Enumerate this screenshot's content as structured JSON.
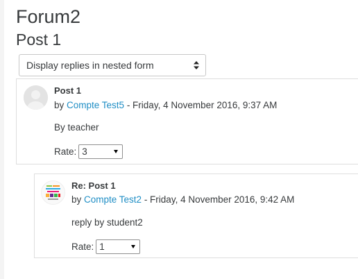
{
  "forum": {
    "title": "Forum2"
  },
  "discussion": {
    "title": "Post 1"
  },
  "display_mode": {
    "selected": "Display replies in nested form"
  },
  "posts": [
    {
      "subject": "Post 1",
      "by_prefix": "by",
      "author": "Compte Test5",
      "date_suffix": " - Friday, 4 November 2016, 9:37 AM",
      "content": "By teacher",
      "rate_label": "Rate:",
      "rate_value": "3",
      "avatar": "default-user-avatar-icon"
    },
    {
      "subject": "Re: Post 1",
      "by_prefix": "by",
      "author": "Compte Test2",
      "date_suffix": " - Friday, 4 November 2016, 9:42 AM",
      "content": "reply by student2",
      "rate_label": "Rate:",
      "rate_value": "1",
      "avatar": "user-picture-icon"
    }
  ],
  "colors": {
    "link": "#1f8ec5",
    "text": "#373a3c",
    "border": "#dedede"
  }
}
